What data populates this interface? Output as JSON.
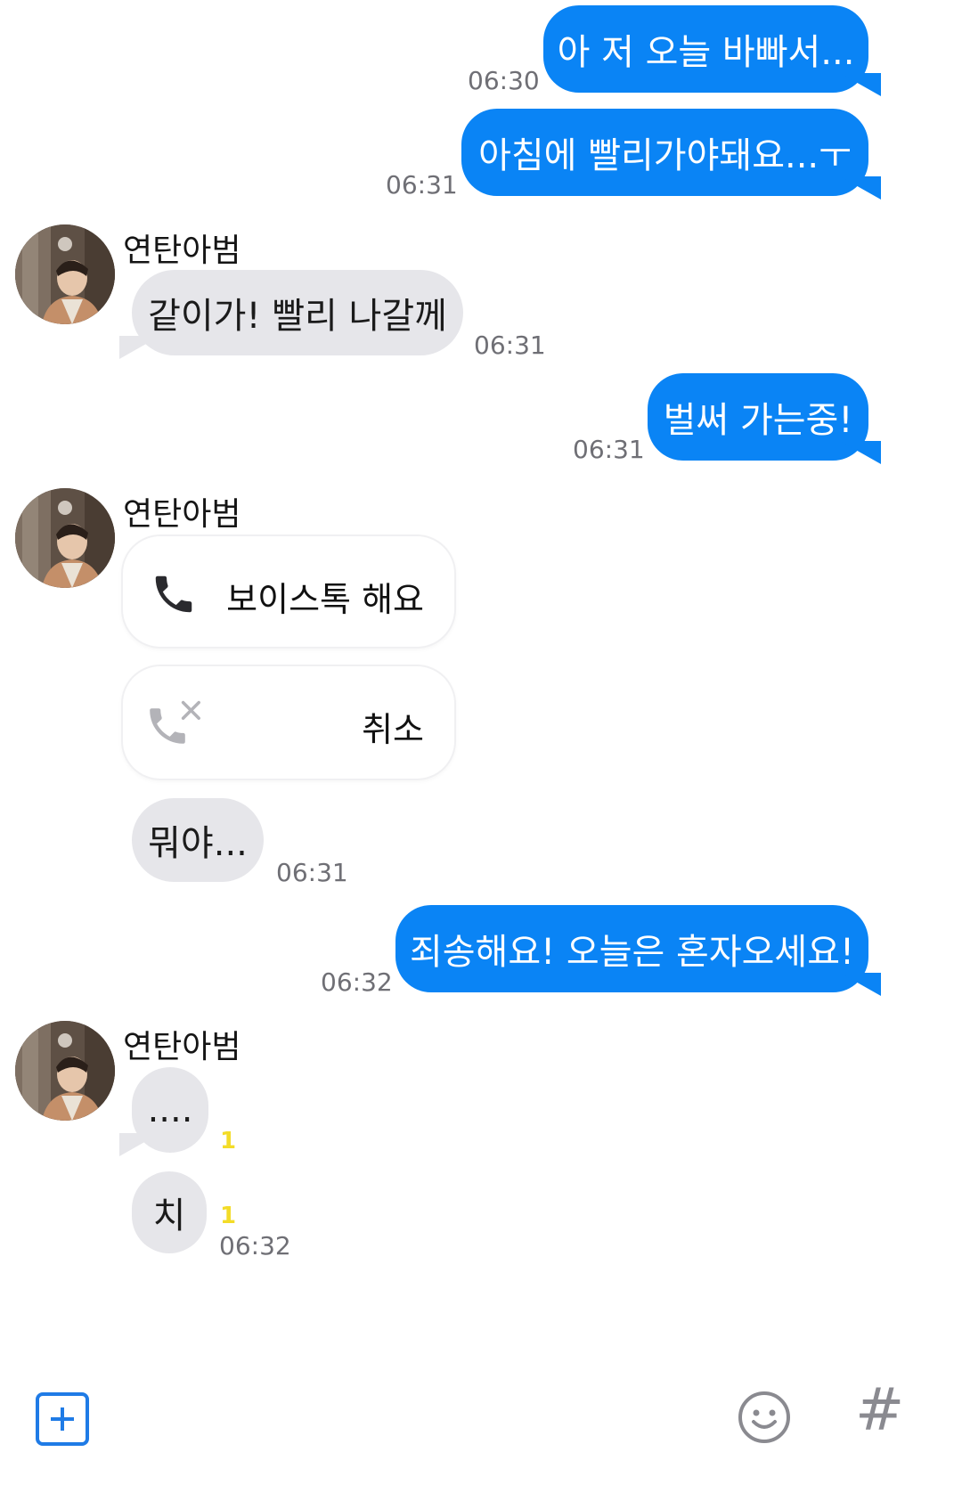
{
  "contact": {
    "name": "연탄아범"
  },
  "messages": [
    {
      "dir": "out",
      "text": "아 저 오늘 바빠서...",
      "time": "06:30"
    },
    {
      "dir": "out",
      "text": "아침에 빨리가야돼요...ㅜ",
      "time": "06:31"
    },
    {
      "dir": "in",
      "text": "같이가! 빨리 나갈께",
      "time": "06:31"
    },
    {
      "dir": "out",
      "text": "벌써 가는중!",
      "time": "06:31"
    },
    {
      "dir": "in",
      "type": "call",
      "text": "보이스톡 해요"
    },
    {
      "dir": "in",
      "type": "call-cancel",
      "text": "취소"
    },
    {
      "dir": "in",
      "text": "뭐야...",
      "time": "06:31"
    },
    {
      "dir": "out",
      "text": "죄송해요! 오늘은 혼자오세요!",
      "time": "06:32"
    },
    {
      "dir": "in",
      "text": "....",
      "unread": "1"
    },
    {
      "dir": "in",
      "text": "치",
      "unread": "1",
      "time": "06:32"
    }
  ],
  "bottom_bar": {
    "icons": [
      "add-icon",
      "emoji-icon",
      "hash-icon"
    ],
    "hash_glyph": "#"
  },
  "colors": {
    "sent_bubble": "#0a84f5",
    "received_bubble": "#e6e6ea",
    "unread_badge": "#f3dc28",
    "accent": "#1f7be6"
  }
}
